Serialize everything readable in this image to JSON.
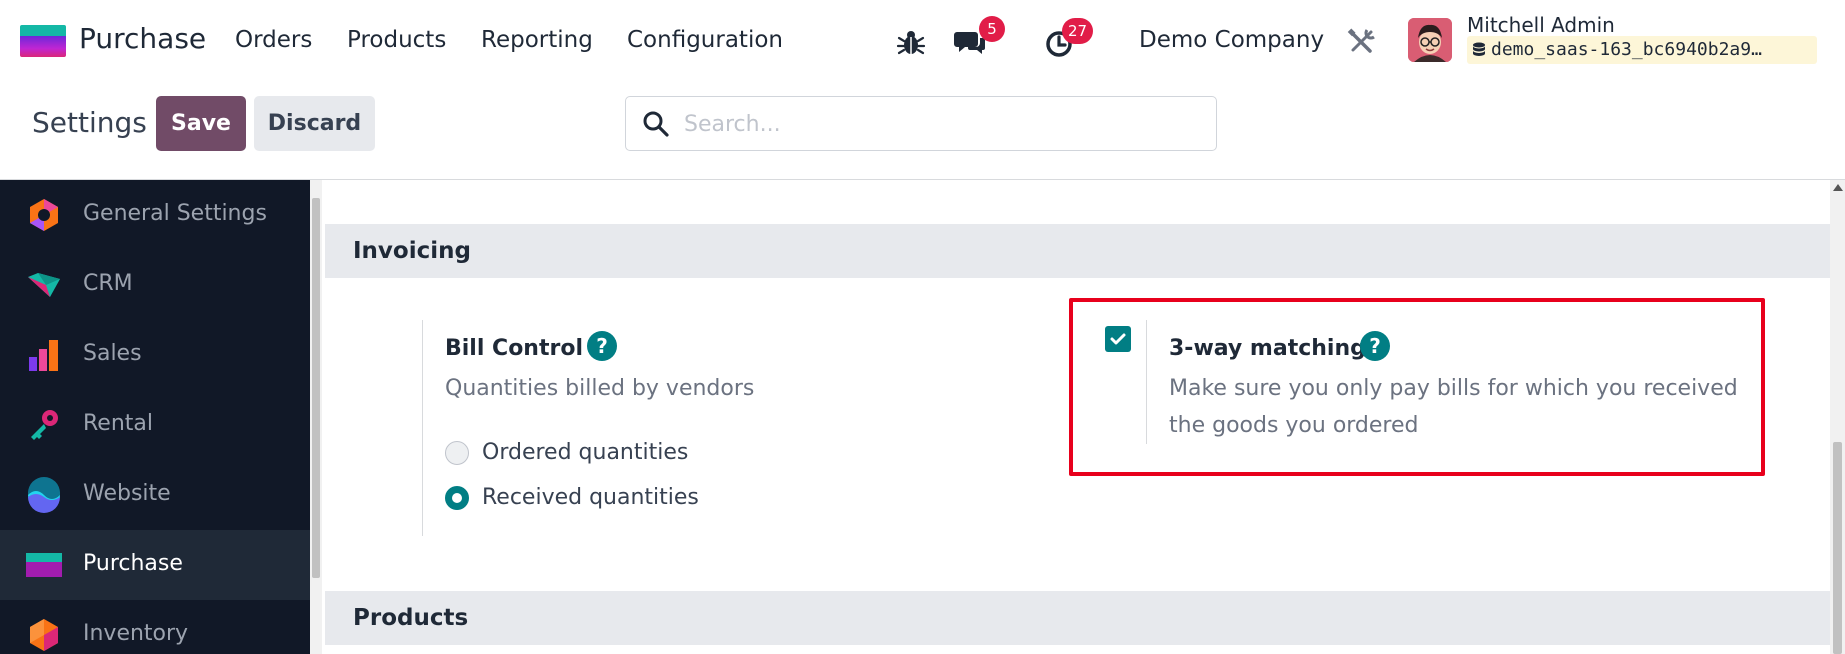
{
  "navbar": {
    "app_name": "Purchase",
    "menu": [
      "Orders",
      "Products",
      "Reporting",
      "Configuration"
    ],
    "messages_badge": "5",
    "activities_badge": "27",
    "company": "Demo Company",
    "user": {
      "name": "Mitchell Admin",
      "database": "demo_saas-163_bc6940b2a9…"
    }
  },
  "control_panel": {
    "title": "Settings",
    "save_label": "Save",
    "discard_label": "Discard",
    "search_placeholder": "Search..."
  },
  "sidebar": {
    "items": [
      {
        "label": "General Settings",
        "icon": "general-settings-icon"
      },
      {
        "label": "CRM",
        "icon": "crm-icon"
      },
      {
        "label": "Sales",
        "icon": "sales-icon"
      },
      {
        "label": "Rental",
        "icon": "rental-icon"
      },
      {
        "label": "Website",
        "icon": "website-icon"
      },
      {
        "label": "Purchase",
        "icon": "purchase-icon",
        "active": true
      },
      {
        "label": "Inventory",
        "icon": "inventory-icon"
      }
    ]
  },
  "sections": {
    "invoicing": {
      "title": "Invoicing",
      "bill_control": {
        "title": "Bill Control",
        "description": "Quantities billed by vendors",
        "options": [
          "Ordered quantities",
          "Received quantities"
        ],
        "selected": "Received quantities"
      },
      "three_way_matching": {
        "title": "3-way matching",
        "description_line1": "Make sure you only pay bills for which you received",
        "description_line2": "the goods you ordered",
        "checked": true
      }
    },
    "products": {
      "title": "Products"
    }
  },
  "colors": {
    "brand": "#714b67",
    "accent": "#017e84",
    "badge": "#e11d48",
    "highlight": "#e8001c",
    "sidebar_bg": "#111827"
  }
}
